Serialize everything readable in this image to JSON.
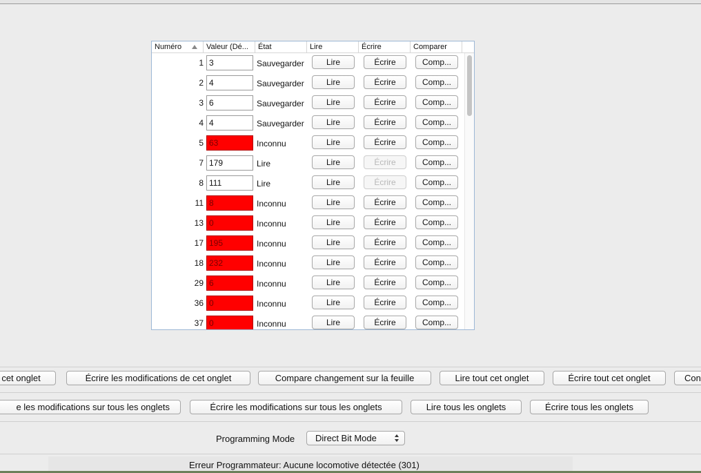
{
  "table": {
    "columns": {
      "number": "Numéro",
      "value": "Valeur (Dé...",
      "state": "État",
      "read": "Lire",
      "write": "Écrire",
      "compare": "Comparer"
    },
    "rows": [
      {
        "num": "1",
        "value": "3",
        "state": "Sauvegarder",
        "unknown": false,
        "read": "Lire",
        "write": "Écrire",
        "write_disabled": false,
        "compare": "Comp..."
      },
      {
        "num": "2",
        "value": "4",
        "state": "Sauvegarder",
        "unknown": false,
        "read": "Lire",
        "write": "Écrire",
        "write_disabled": false,
        "compare": "Comp..."
      },
      {
        "num": "3",
        "value": "6",
        "state": "Sauvegarder",
        "unknown": false,
        "read": "Lire",
        "write": "Écrire",
        "write_disabled": false,
        "compare": "Comp..."
      },
      {
        "num": "4",
        "value": "4",
        "state": "Sauvegarder",
        "unknown": false,
        "read": "Lire",
        "write": "Écrire",
        "write_disabled": false,
        "compare": "Comp..."
      },
      {
        "num": "5",
        "value": "63",
        "state": "Inconnu",
        "unknown": true,
        "read": "Lire",
        "write": "Écrire",
        "write_disabled": false,
        "compare": "Comp..."
      },
      {
        "num": "7",
        "value": "179",
        "state": "Lire",
        "unknown": false,
        "read": "Lire",
        "write": "Écrire",
        "write_disabled": true,
        "compare": "Comp..."
      },
      {
        "num": "8",
        "value": "111",
        "state": "Lire",
        "unknown": false,
        "read": "Lire",
        "write": "Écrire",
        "write_disabled": true,
        "compare": "Comp..."
      },
      {
        "num": "11",
        "value": "8",
        "state": "Inconnu",
        "unknown": true,
        "read": "Lire",
        "write": "Écrire",
        "write_disabled": false,
        "compare": "Comp..."
      },
      {
        "num": "13",
        "value": "0",
        "state": "Inconnu",
        "unknown": true,
        "read": "Lire",
        "write": "Écrire",
        "write_disabled": false,
        "compare": "Comp..."
      },
      {
        "num": "17",
        "value": "195",
        "state": "Inconnu",
        "unknown": true,
        "read": "Lire",
        "write": "Écrire",
        "write_disabled": false,
        "compare": "Comp..."
      },
      {
        "num": "18",
        "value": "232",
        "state": "Inconnu",
        "unknown": true,
        "read": "Lire",
        "write": "Écrire",
        "write_disabled": false,
        "compare": "Comp..."
      },
      {
        "num": "29",
        "value": "6",
        "state": "Inconnu",
        "unknown": true,
        "read": "Lire",
        "write": "Écrire",
        "write_disabled": false,
        "compare": "Comp..."
      },
      {
        "num": "36",
        "value": "0",
        "state": "Inconnu",
        "unknown": true,
        "read": "Lire",
        "write": "Écrire",
        "write_disabled": false,
        "compare": "Comp..."
      },
      {
        "num": "37",
        "value": "0",
        "state": "Inconnu",
        "unknown": true,
        "read": "Lire",
        "write": "Écrire",
        "write_disabled": false,
        "compare": "Comp..."
      }
    ]
  },
  "toolbar_sheet": {
    "read_changes": "cet onglet",
    "write_changes": "Écrire les modifications de cet onglet",
    "compare_sheet": "Compare changement sur la feuille",
    "read_all": "Lire tout cet onglet",
    "write_all": "Écrire tout cet onglet",
    "compare_all": "Con"
  },
  "toolbar_all": {
    "read_changes_all": "e les modifications sur tous les onglets",
    "write_changes_all": "Écrire les modifications sur tous les onglets",
    "read_all_tabs": "Lire tous les onglets",
    "write_all_tabs": "Écrire tous les onglets"
  },
  "programming": {
    "label": "Programming Mode",
    "selected": "Direct Bit Mode"
  },
  "status": {
    "message": "Erreur Programmateur: Aucune locomotive détectée (301)"
  },
  "colors": {
    "unknown_value_bg": "#ff0000",
    "table_border": "#9cb7d6"
  },
  "icons": {
    "sort": "sort-ascending-icon",
    "select": "updown-chevron-icon"
  }
}
